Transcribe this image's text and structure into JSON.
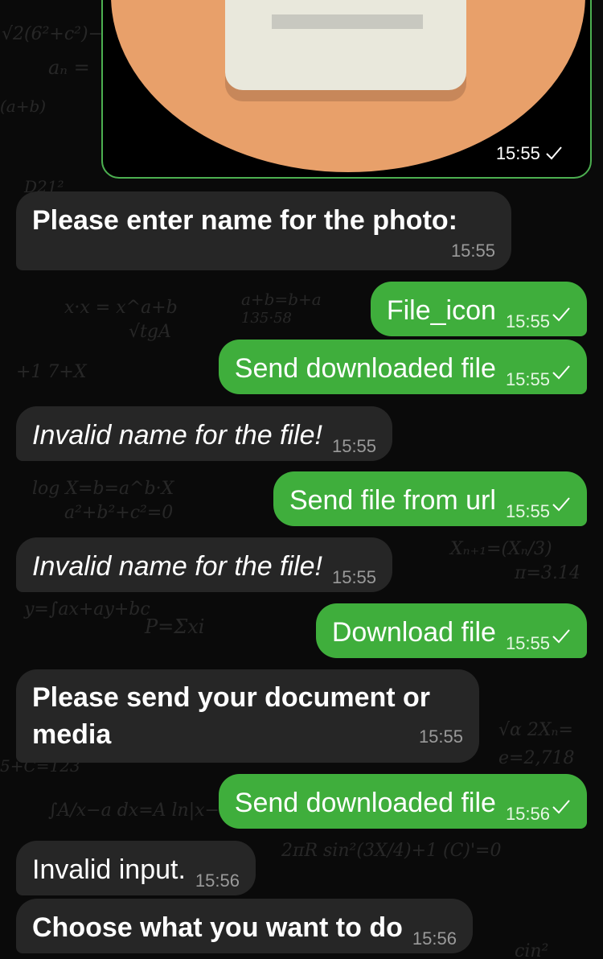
{
  "photo": {
    "time": "15:55",
    "check_icon": "check-icon"
  },
  "messages": [
    {
      "id": "m1",
      "direction": "in",
      "text": "Please enter name for the photo:",
      "time": "15:55",
      "style": "bold"
    },
    {
      "id": "m2",
      "direction": "out",
      "text": "File_icon",
      "time": "15:55",
      "style": "normal"
    },
    {
      "id": "m3",
      "direction": "out",
      "text": "Send downloaded file",
      "time": "15:55",
      "style": "normal"
    },
    {
      "id": "m4",
      "direction": "in",
      "text": "Invalid name for the file!",
      "time": "15:55",
      "style": "italic"
    },
    {
      "id": "m5",
      "direction": "out",
      "text": "Send file from url",
      "time": "15:55",
      "style": "normal"
    },
    {
      "id": "m6",
      "direction": "in",
      "text": "Invalid name for the file!",
      "time": "15:55",
      "style": "italic"
    },
    {
      "id": "m7",
      "direction": "out",
      "text": "Download file",
      "time": "15:55",
      "style": "normal"
    },
    {
      "id": "m8",
      "direction": "in",
      "text_line1": "Please send your document or",
      "text_line2": "media",
      "time": "15:55",
      "style": "bold"
    },
    {
      "id": "m9",
      "direction": "out",
      "text": "Send downloaded file",
      "time": "15:56",
      "style": "normal"
    },
    {
      "id": "m10",
      "direction": "in",
      "text": "Invalid input.",
      "time": "15:56",
      "style": "normal"
    },
    {
      "id": "m11",
      "direction": "in",
      "text": "Choose what you want to do",
      "time": "15:56",
      "style": "bold"
    }
  ],
  "colors": {
    "background": "#0a0a0a",
    "incoming_bubble": "#262626",
    "outgoing_bubble": "#3fae3c",
    "photo_border": "#4caf50",
    "photo_circle": "#e8a06a",
    "photo_card": "#e9e8dc"
  }
}
